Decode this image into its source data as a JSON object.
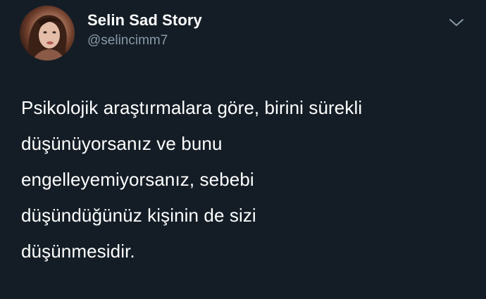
{
  "tweet": {
    "author": {
      "display_name": "Selin Sad Story",
      "handle": "@selincimm7",
      "avatar_icon": "profile-photo"
    },
    "menu_icon": "chevron-down-icon",
    "text": "Psikolojik araştırmalara göre, birini sürekli\ndüşünüyorsanız ve bunu\nengelleyemiyorsanız, sebebi\ndüşündüğünüz kişinin de sizi\ndüşünmesidir.",
    "colors": {
      "background": "#141d26",
      "text": "#ffffff",
      "secondary_text": "#8899a6"
    }
  }
}
